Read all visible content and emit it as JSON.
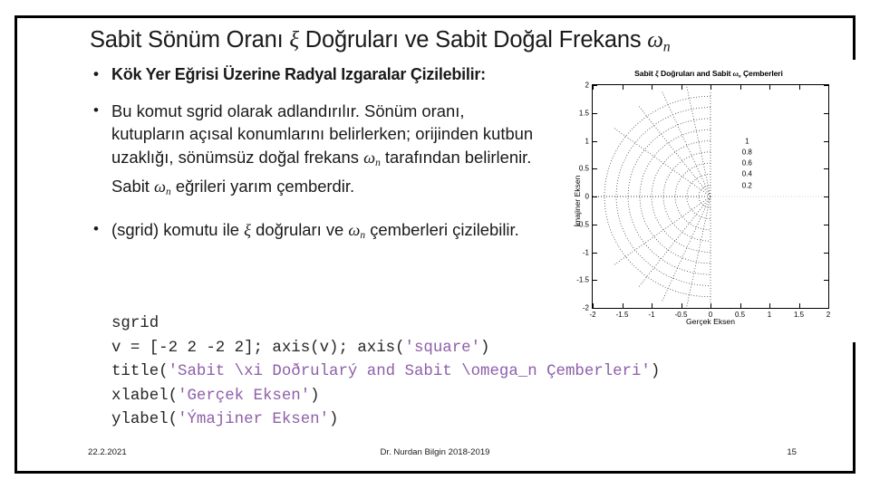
{
  "slide": {
    "title_parts": [
      "Sabit Sönüm Oranı ",
      "ξ",
      " Doğruları ve Sabit Doğal Frekans ",
      "ω",
      "n"
    ],
    "title_plain": "Sabit Sönüm Oranı ξ Doğruları ve Sabit Doğal Frekans ωn"
  },
  "bullets": [
    {
      "text": "Kök Yer Eğrisi Üzerine Radyal Izgaralar Çizilebilir:"
    },
    {
      "text": "Bu komut sgrid olarak adlandırılır. Sönüm oranı, kutupların açısal konumlarını belirlerken; orijinden kutbun uzaklığı, sönümsüz doğal frekans ωn tarafından belirlenir. Sabit ωn eğrileri yarım çemberdir."
    },
    {
      "text": "(sgrid) komutu ile ξ doğruları ve ωn çemberleri çizilebilir."
    }
  ],
  "bullet_runs": {
    "b2": [
      {
        "t": "Bu komut sgrid olarak adlandırılır. Sönüm oranı, kutupların açısal konumlarını belirlerken; orijinden kutbun uzaklığı, sönümsüz doğal frekans ",
        "i": false
      },
      {
        "t": "ω",
        "i": true
      },
      {
        "t": "n",
        "i": "sub"
      },
      {
        "t": " tarafından belirlenir. Sabit ",
        "i": false
      },
      {
        "t": "ω",
        "i": true
      },
      {
        "t": "n",
        "i": "sub"
      },
      {
        "t": " eğrileri yarım çemberdir.",
        "i": false
      }
    ],
    "b3": [
      {
        "t": "(sgrid) komutu ile ",
        "i": false
      },
      {
        "t": "ξ",
        "i": true
      },
      {
        "t": " doğruları ve ",
        "i": false
      },
      {
        "t": "ω",
        "i": true
      },
      {
        "t": "n",
        "i": "sub"
      },
      {
        "t": " çemberleri çizilebilir.",
        "i": false
      }
    ]
  },
  "code": {
    "lines": [
      [
        {
          "t": "sgrid",
          "s": false
        }
      ],
      [
        {
          "t": "v = [-2 2 -2 2]; axis(v); axis(",
          "s": false
        },
        {
          "t": "'square'",
          "s": true
        },
        {
          "t": ")",
          "s": false
        }
      ],
      [
        {
          "t": "title(",
          "s": false
        },
        {
          "t": "'Sabit \\xi Doðrularý and Sabit \\omega_n Çemberleri'",
          "s": true
        },
        {
          "t": ")",
          "s": false
        }
      ],
      [
        {
          "t": "xlabel(",
          "s": false
        },
        {
          "t": "'Gerçek Eksen'",
          "s": true
        },
        {
          "t": ")",
          "s": false
        }
      ],
      [
        {
          "t": "ylabel(",
          "s": false
        },
        {
          "t": "'Ýmajiner Eksen'",
          "s": true
        },
        {
          "t": ")",
          "s": false
        }
      ]
    ],
    "string_color": "#8e5fa8",
    "text_color": "#262626"
  },
  "footer": {
    "date": "22.2.2021",
    "center": "Dr. Nurdan Bilgin 2018-2019",
    "page": "15"
  },
  "chart_data": {
    "type": "line",
    "title": "Sabit ξ Doğruları and Sabit ωn Çemberleri",
    "title_parts": [
      "Sabit ",
      "ξ",
      " Doğruları and Sabit ",
      "ω",
      "n",
      " Çemberleri"
    ],
    "xlabel": "Gerçek Eksen",
    "ylabel": "İmajiner Eksen",
    "xlim": [
      -2,
      2
    ],
    "ylim": [
      -2,
      2
    ],
    "xticks": [
      -2,
      -1.5,
      -1,
      -0.5,
      0,
      0.5,
      1,
      1.5,
      2
    ],
    "xticklabels": [
      "-2",
      "-1.5",
      "-1",
      "-0.5",
      "0",
      "0.5",
      "1",
      "1.5",
      "2"
    ],
    "yticks": [
      -2,
      -1.5,
      -1,
      -0.5,
      0,
      0.5,
      1,
      1.5,
      2
    ],
    "yticklabels": [
      "-2",
      "-1.5",
      "-1",
      "-0.5",
      "0",
      "0.5",
      "1",
      "1.5",
      "2"
    ],
    "grid": true,
    "grid_style": "dotted",
    "legend": null,
    "aspect": "square",
    "series": [
      {
        "name": "damping ratio lines (zeta)",
        "kind": "radial-rays",
        "zeta_values": [
          0.2,
          0.4,
          0.6,
          0.8,
          1.0
        ],
        "annotations": [
          "1",
          "0.8",
          "0.6",
          "0.4",
          "0.2"
        ],
        "annotation_x": [
          0.62,
          0.62,
          0.62,
          0.62,
          0.62
        ],
        "annotation_y": [
          1.0,
          0.8,
          0.6,
          0.4,
          0.2
        ],
        "half_plane": "left"
      },
      {
        "name": "natural frequency semicircles (omega_n)",
        "kind": "semicircles",
        "radii": [
          0.2,
          0.4,
          0.6,
          0.8,
          1.0,
          1.2,
          1.4,
          1.6,
          1.8
        ],
        "half_plane": "left"
      }
    ]
  }
}
